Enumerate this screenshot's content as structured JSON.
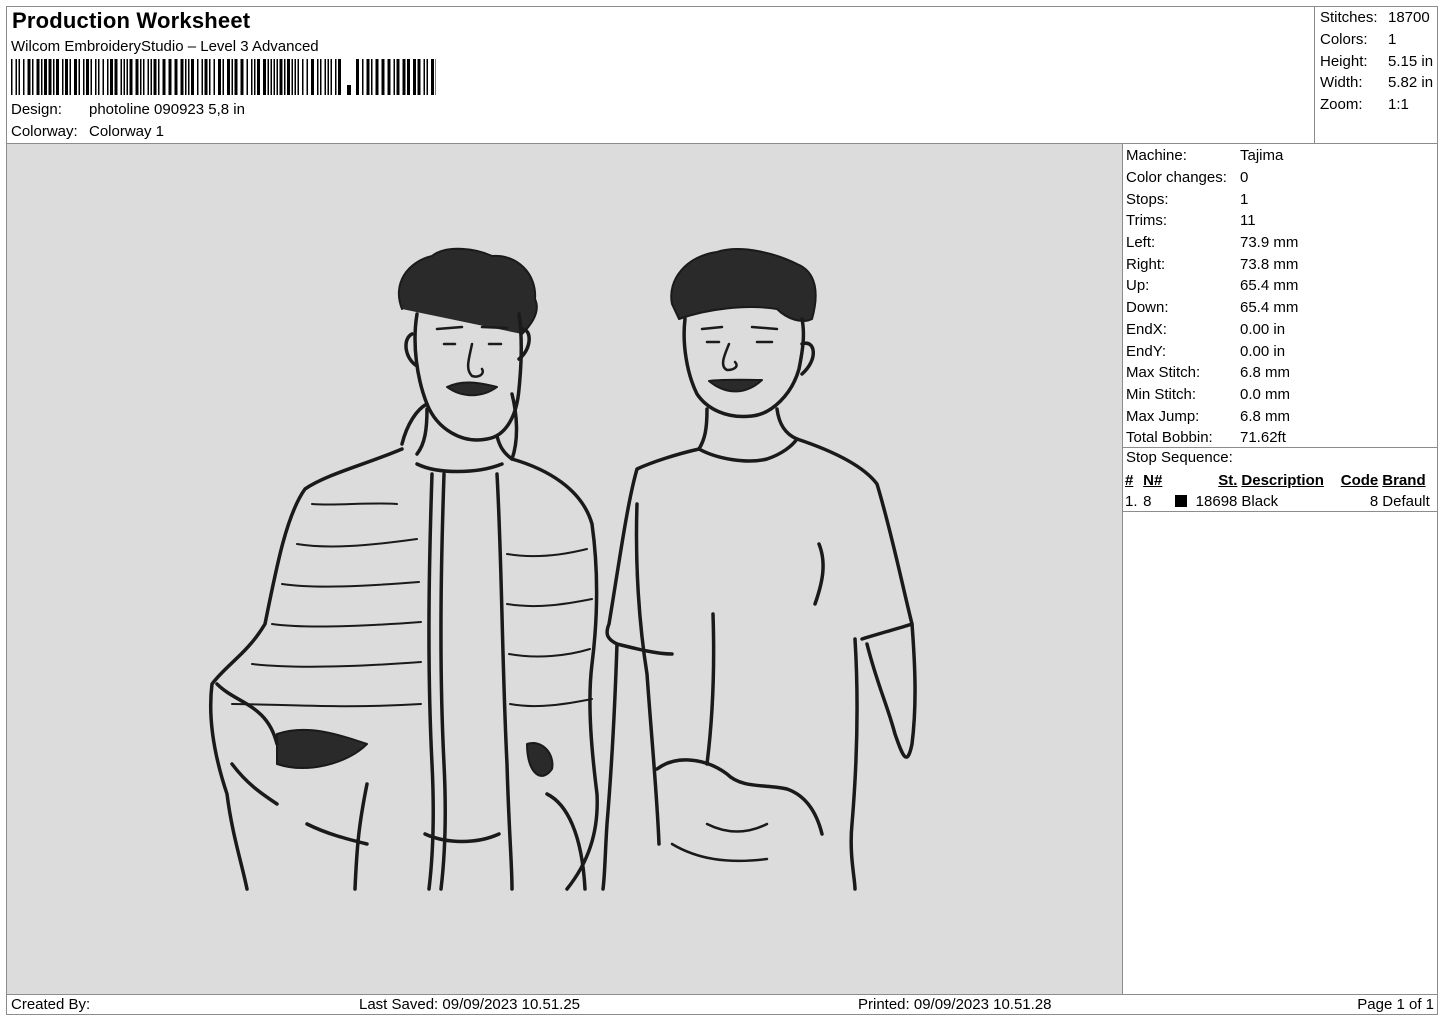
{
  "header": {
    "title": "Production Worksheet",
    "software": "Wilcom EmbroideryStudio – Level 3 Advanced",
    "design_label": "Design:",
    "design_value": "photoline 090923 5,8 in",
    "colorway_label": "Colorway:",
    "colorway_value": "Colorway 1"
  },
  "summary": [
    {
      "label": "Stitches:",
      "value": "18700"
    },
    {
      "label": "Colors:",
      "value": "1"
    },
    {
      "label": "Height:",
      "value": "5.15 in"
    },
    {
      "label": "Width:",
      "value": "5.82 in"
    },
    {
      "label": "Zoom:",
      "value": "1:1"
    }
  ],
  "machine_info": [
    {
      "label": "Machine:",
      "value": "Tajima"
    },
    {
      "label": "Color changes:",
      "value": "0"
    },
    {
      "label": "Stops:",
      "value": "1"
    },
    {
      "label": "Trims:",
      "value": "11"
    },
    {
      "label": "Left:",
      "value": "73.9 mm"
    },
    {
      "label": "Right:",
      "value": "73.8 mm"
    },
    {
      "label": "Up:",
      "value": "65.4 mm"
    },
    {
      "label": "Down:",
      "value": "65.4 mm"
    },
    {
      "label": "EndX:",
      "value": "0.00 in"
    },
    {
      "label": "EndY:",
      "value": "0.00 in"
    },
    {
      "label": "Max Stitch:",
      "value": "6.8 mm"
    },
    {
      "label": "Min Stitch:",
      "value": "0.0 mm"
    },
    {
      "label": "Max Jump:",
      "value": "6.8 mm"
    },
    {
      "label": "Total Bobbin:",
      "value": "71.62ft"
    }
  ],
  "stop_sequence": {
    "title": "Stop Sequence:",
    "columns": [
      "#",
      "N#",
      "St.",
      "Description",
      "Code",
      "Brand"
    ],
    "rows": [
      {
        "num": "1.",
        "needle": "8",
        "stitches": "18698",
        "description": "Black",
        "code": "8",
        "brand": "Default",
        "color": "#000000"
      }
    ]
  },
  "footer": {
    "created_by": "Created By:",
    "last_saved": "Last Saved: 09/09/2023 10.51.25",
    "printed": "Printed: 09/09/2023 10.51.28",
    "page": "Page 1 of 1"
  },
  "design_preview": {
    "background": "#dcdcdc",
    "thread_color": "#1a1a1a",
    "icon": "embroidery-design-two-men-lineart"
  }
}
